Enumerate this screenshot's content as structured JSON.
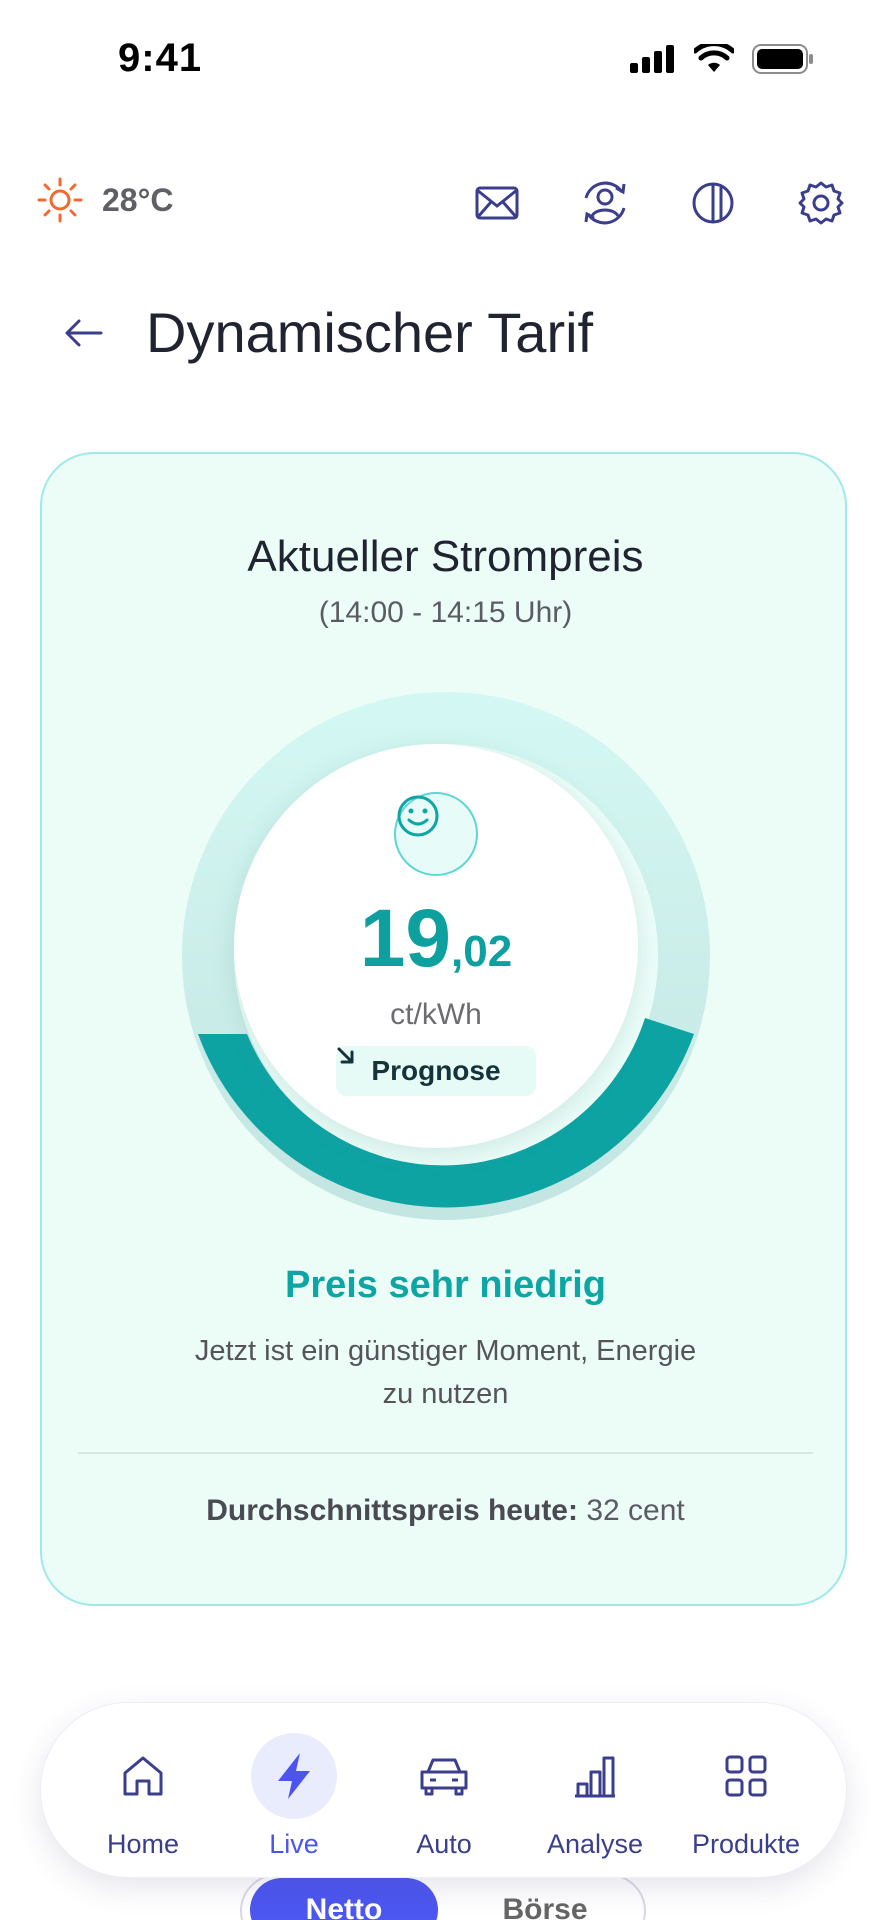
{
  "status_bar": {
    "time": "9:41"
  },
  "weather": {
    "temperature": "28°C",
    "icon": "sun-icon"
  },
  "header_icons": [
    "mail-icon",
    "account-sync-icon",
    "contrast-icon",
    "gear-icon"
  ],
  "page": {
    "title": "Dynamischer Tarif"
  },
  "price_card": {
    "title": "Aktueller Strompreis",
    "time_range": "(14:00 - 14:15 Uhr)",
    "price_integer": "19",
    "price_decimal": ",02",
    "unit": "ct/kWh",
    "prognose_label": "Prognose",
    "status_label": "Preis sehr niedrig",
    "status_description": "Jetzt ist ein günstiger Moment, Energie zu nutzen",
    "average_label": "Durchschnittspreis heute:",
    "average_value": "32 cent",
    "colors": {
      "accent": "#0ea5a5",
      "card_bg": "#ecfdf8",
      "ring_light": "#cdf2ee"
    }
  },
  "nav": {
    "items": [
      {
        "label": "Home",
        "icon": "home-icon",
        "active": false
      },
      {
        "label": "Live",
        "icon": "lightning-icon",
        "active": true
      },
      {
        "label": "Auto",
        "icon": "car-icon",
        "active": false
      },
      {
        "label": "Analyse",
        "icon": "bar-chart-icon",
        "active": false
      },
      {
        "label": "Produkte",
        "icon": "grid-icon",
        "active": false
      }
    ],
    "accent": "#4b54ef"
  },
  "toggle": {
    "netto_label": "Netto",
    "borse_label": "Börse",
    "selected": "Netto"
  }
}
